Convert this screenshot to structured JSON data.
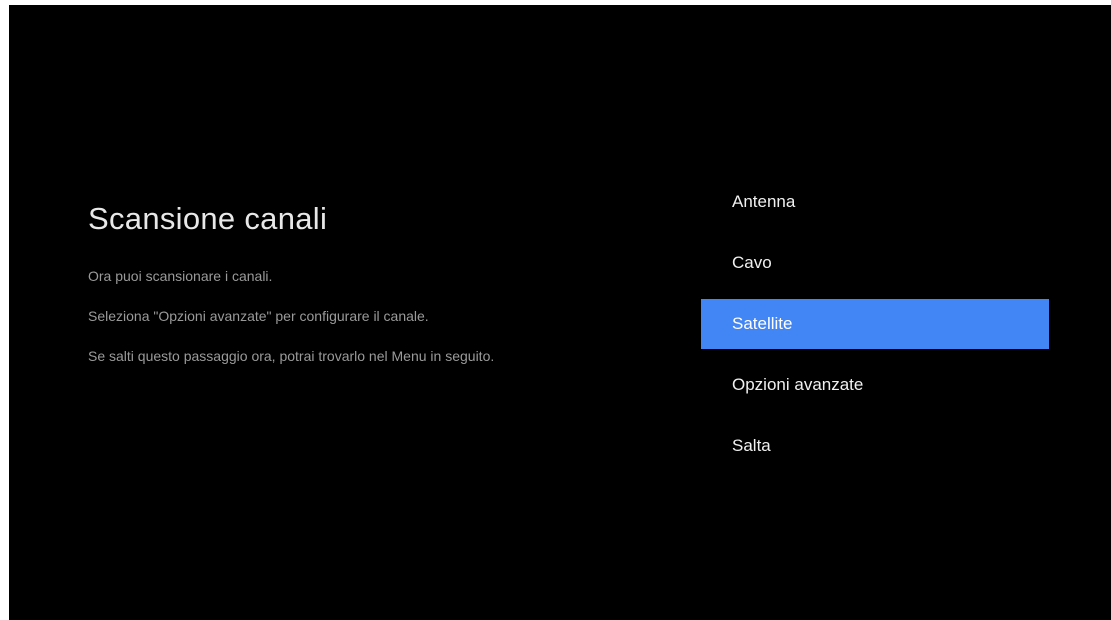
{
  "screen": {
    "title": "Scansione canali",
    "descriptions": [
      "Ora puoi scansionare i canali.",
      "Seleziona \"Opzioni avanzate\" per configurare il canale.",
      "Se salti questo passaggio ora, potrai trovarlo nel Menu in seguito."
    ]
  },
  "menu": {
    "items": [
      {
        "label": "Antenna"
      },
      {
        "label": "Cavo"
      },
      {
        "label": "Satellite"
      },
      {
        "label": "Opzioni avanzate"
      },
      {
        "label": "Salta"
      }
    ],
    "selected_label": "Satellite"
  },
  "colors": {
    "background": "#000000",
    "accent": "#4285f4"
  }
}
